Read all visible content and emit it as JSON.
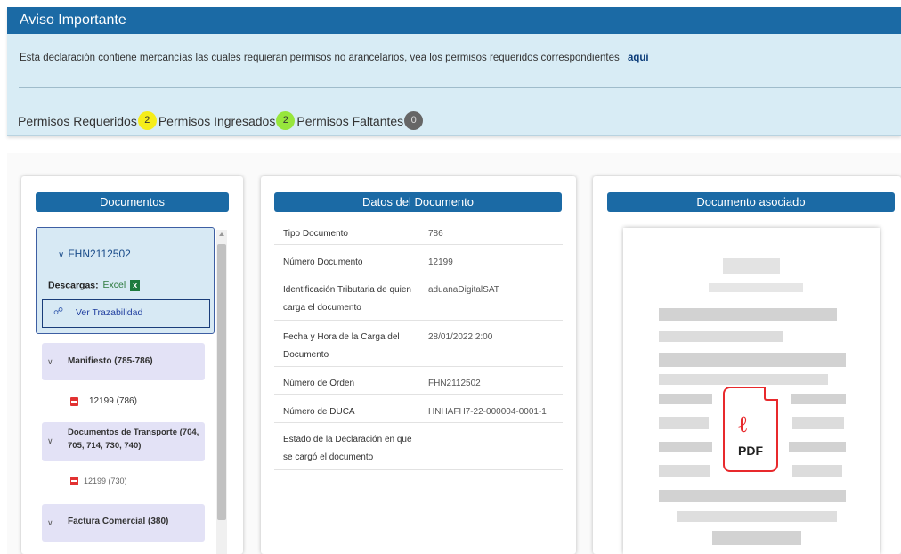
{
  "alert": {
    "title": "Aviso Importante",
    "message": "Esta declaración contiene mercancías las cuales requieran permisos no arancelarios, vea los permisos requeridos correspondientes",
    "link_label": "aqui",
    "permits": {
      "required_label": "Permisos Requeridos",
      "required_count": "2",
      "entered_label": "Permisos Ingresados",
      "entered_count": "2",
      "missing_label": "Permisos Faltantes",
      "missing_count": "0",
      "colors": {
        "required": "#f6ed1a",
        "entered": "#97e63c",
        "missing": "#666666"
      }
    }
  },
  "documentos": {
    "title": "Documentos",
    "root": {
      "label": "FHN2112502",
      "descargas_label": "Descargas:",
      "excel_label": "Excel",
      "trazabilidad_label": "Ver Trazabilidad"
    },
    "groups": [
      {
        "label": "Manifiesto (785-786)",
        "items": [
          "12199 (786)"
        ]
      },
      {
        "label": "Documentos de Transporte (704, 705, 714, 730, 740)",
        "items": [
          "12199 (730)"
        ]
      },
      {
        "label": "Factura Comercial (380)",
        "items": []
      }
    ]
  },
  "datos": {
    "title": "Datos del Documento",
    "rows": [
      {
        "label": "Tipo Documento",
        "value": "786"
      },
      {
        "label": "Número Documento",
        "value": "12199"
      },
      {
        "label": "Identificación Tributaria de quien carga el documento",
        "value": "aduanaDigitalSAT"
      },
      {
        "label": "Fecha y Hora de la Carga del Documento",
        "value": "28/01/2022 2:00"
      },
      {
        "label": "Número de Orden",
        "value": "FHN2112502"
      },
      {
        "label": "Número de DUCA",
        "value": "HNHAFH7-22-000004-0001-1"
      },
      {
        "label": "Estado de la Declaración en que se cargó el documento",
        "value": ""
      }
    ]
  },
  "asociado": {
    "title": "Documento asociado",
    "preview_icon_label": "PDF"
  },
  "colors": {
    "header_blue": "#1b6aa5",
    "alert_bg": "#d8ecf5",
    "group_bg": "#e3e2f6",
    "pdf_red": "#e8292c"
  }
}
